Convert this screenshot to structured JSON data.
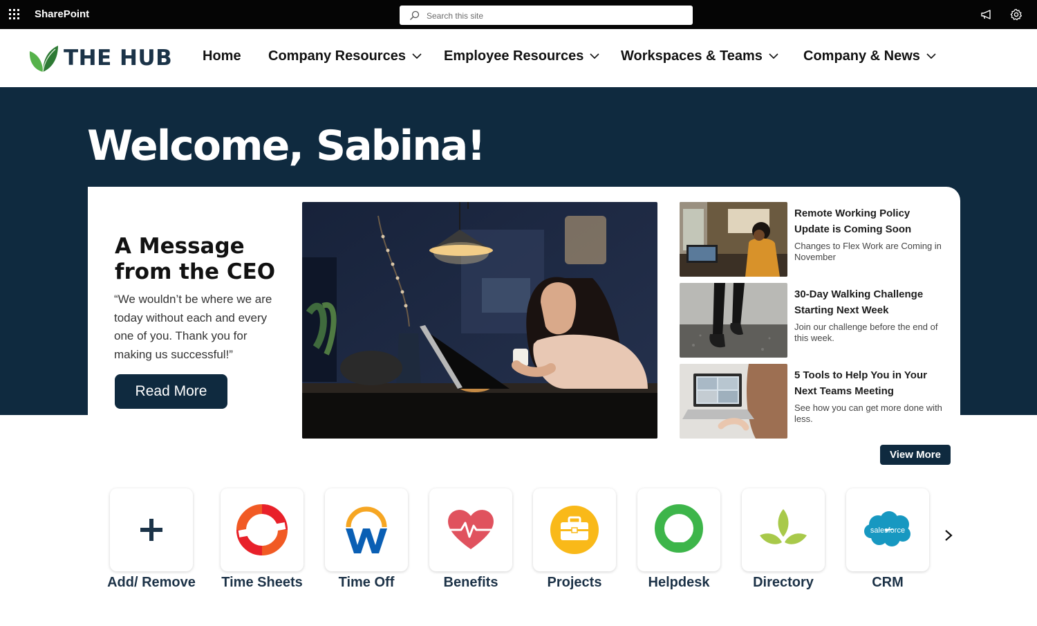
{
  "suite": {
    "app_name": "SharePoint",
    "search_placeholder": "Search this site",
    "icons": [
      "app-launcher-icon",
      "search-icon",
      "megaphone-icon",
      "settings-icon"
    ]
  },
  "header": {
    "logo_text": "THE HUB",
    "nav": [
      {
        "label": "Home",
        "dropdown": false
      },
      {
        "label": "Company Resources",
        "dropdown": true
      },
      {
        "label": "Employee Resources",
        "dropdown": true
      },
      {
        "label": "Workspaces & Teams",
        "dropdown": true
      },
      {
        "label": "Company & News",
        "dropdown": true
      }
    ]
  },
  "hero": {
    "welcome": "Welcome, Sabina!",
    "ceo": {
      "title": "A Message from the CEO",
      "quote": "“We wouldn’t be where we are today without each and every one of you. Thank you for making us successful!”",
      "button": "Read More"
    },
    "news": [
      {
        "title": "Remote Working Policy Update is Coming Soon",
        "desc": "Changes to Flex Work are Coming in November"
      },
      {
        "title": "30-Day Walking Challenge Starting Next Week",
        "desc": "Join our challenge before the end of this week."
      },
      {
        "title": "5 Tools to Help You in Your Next Teams Meeting",
        "desc": "See how you can get more done with less."
      }
    ],
    "view_more": "View More"
  },
  "quick_links": [
    {
      "label": "Add/ Remove",
      "icon": "plus-icon"
    },
    {
      "label": "Time Sheets",
      "icon": "time-sheets-icon"
    },
    {
      "label": "Time Off",
      "icon": "time-off-icon"
    },
    {
      "label": "Benefits",
      "icon": "heart-pulse-icon"
    },
    {
      "label": "Projects",
      "icon": "briefcase-icon"
    },
    {
      "label": "Helpdesk",
      "icon": "helpdesk-icon"
    },
    {
      "label": "Directory",
      "icon": "leaf-icon"
    },
    {
      "label": "CRM",
      "icon": "salesforce-icon",
      "logo_text": "salesforce"
    }
  ],
  "colors": {
    "navy": "#0f2a3f",
    "suite_bar": "#050505",
    "logo_green": "#2e8b3a"
  }
}
